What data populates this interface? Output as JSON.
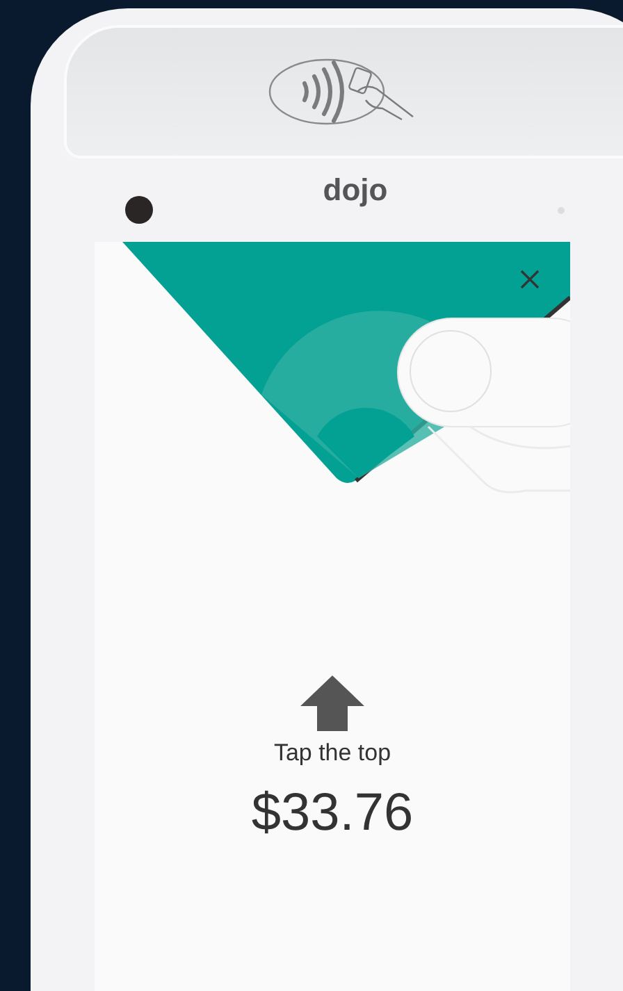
{
  "logo": "dojo",
  "screen": {
    "instruction": "Tap the top",
    "amount": "$33.76"
  }
}
